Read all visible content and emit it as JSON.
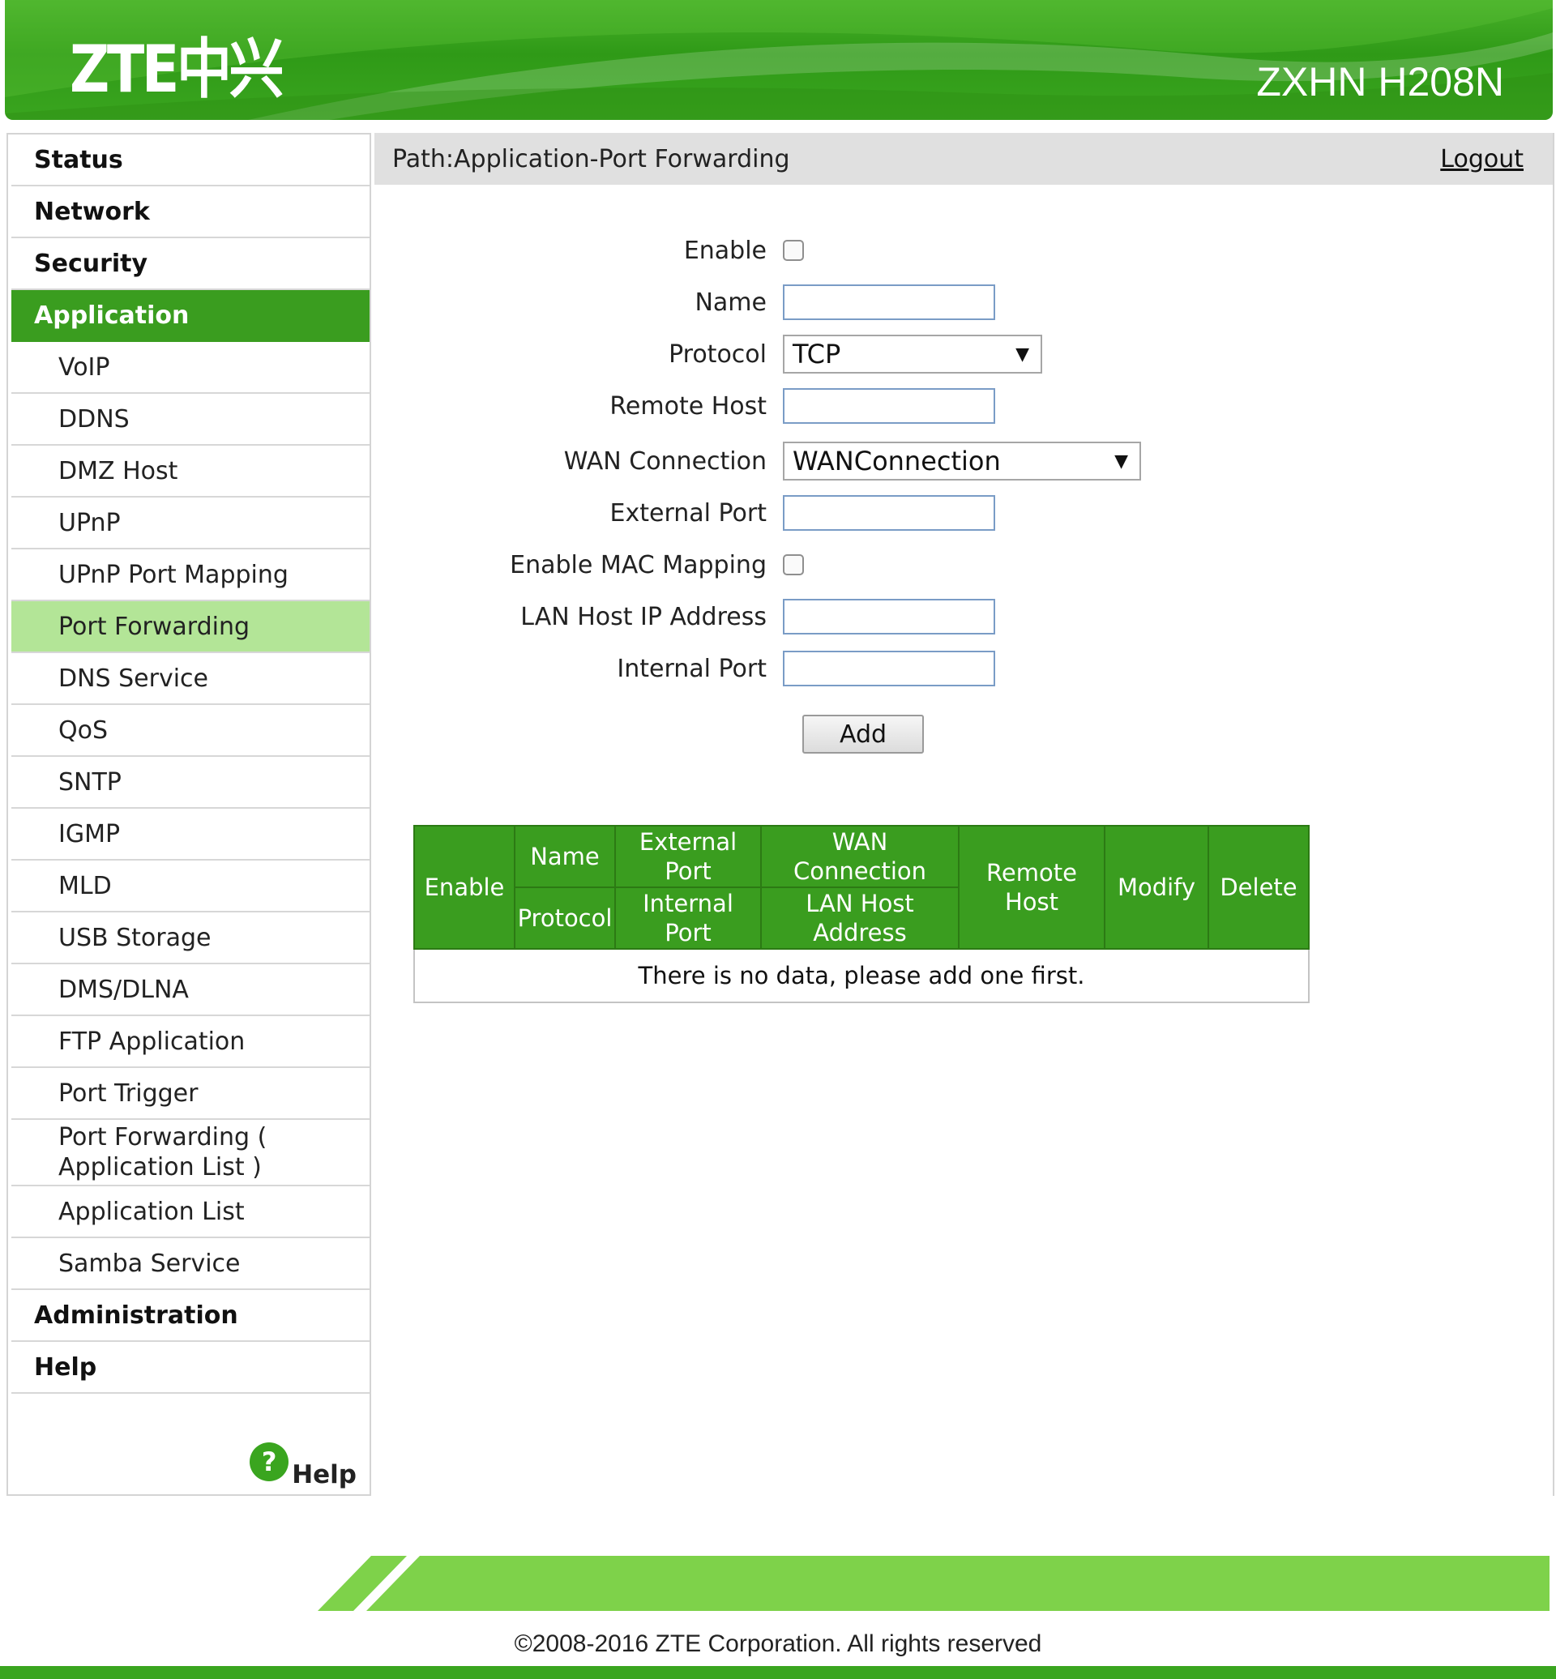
{
  "header": {
    "logo_text": "ZTE中兴",
    "model": "ZXHN H208N"
  },
  "pathbar": {
    "path": "Path:Application-Port Forwarding",
    "logout": "Logout"
  },
  "sidebar": {
    "items": [
      {
        "label": "Status"
      },
      {
        "label": "Network"
      },
      {
        "label": "Security"
      },
      {
        "label": "Application"
      },
      {
        "label": "VoIP"
      },
      {
        "label": "DDNS"
      },
      {
        "label": "DMZ Host"
      },
      {
        "label": "UPnP"
      },
      {
        "label": "UPnP Port Mapping"
      },
      {
        "label": "Port Forwarding"
      },
      {
        "label": "DNS Service"
      },
      {
        "label": "QoS"
      },
      {
        "label": "SNTP"
      },
      {
        "label": "IGMP"
      },
      {
        "label": "MLD"
      },
      {
        "label": "USB Storage"
      },
      {
        "label": "DMS/DLNA"
      },
      {
        "label": "FTP Application"
      },
      {
        "label": "Port Trigger"
      },
      {
        "label": "Port Forwarding (\nApplication List )"
      },
      {
        "label": "Application List"
      },
      {
        "label": "Samba Service"
      },
      {
        "label": "Administration"
      },
      {
        "label": "Help"
      }
    ],
    "help_icon_glyph": "?",
    "help_label": "Help"
  },
  "form": {
    "enable_label": "Enable",
    "name_label": "Name",
    "name_value": "",
    "protocol_label": "Protocol",
    "protocol_value": "TCP",
    "remote_host_label": "Remote Host",
    "remote_host_value": "",
    "wan_connection_label": "WAN Connection",
    "wan_connection_value": "WANConnection",
    "external_port_label": "External Port",
    "external_port_value": "",
    "enable_mac_label": "Enable MAC Mapping",
    "lan_host_ip_label": "LAN Host IP Address",
    "lan_host_ip_value": "",
    "internal_port_label": "Internal Port",
    "internal_port_value": "",
    "add_label": "Add",
    "dropdown_arrow": "▼"
  },
  "table": {
    "headers": {
      "enable": "Enable",
      "name": "Name",
      "protocol": "Protocol",
      "external_port": "External\nPort",
      "internal_port": "Internal\nPort",
      "wan_connection": "WAN\nConnection",
      "lan_host_address": "LAN Host\nAddress",
      "remote_host": "Remote\nHost",
      "modify": "Modify",
      "delete": "Delete"
    },
    "empty_message": "There is no data, please add one first."
  },
  "footer": {
    "copyright": "©2008-2016 ZTE Corporation. All rights reserved"
  },
  "colors": {
    "brand_green": "#3a9d1f",
    "active_sub": "#b3e597",
    "footer_green": "#7ed24a"
  }
}
